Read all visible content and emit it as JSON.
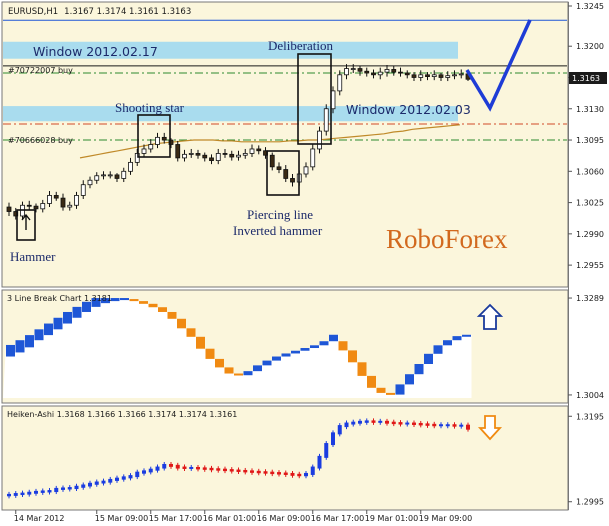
{
  "colors": {
    "panel_bg": "#fbf6dc",
    "hist_bg": "#ffffff",
    "axis_bg": "#ffffff",
    "bull": "#ffffff",
    "bear": "#3a2a14",
    "window_fill": "#a9dcee",
    "ma_line": "#c08a2a",
    "blue_box": "#1e56d6",
    "orange_box": "#f08a12",
    "ha_blue": "#1a3ce0",
    "ha_red": "#e01818",
    "level_green": "#2e8b2e",
    "level_red": "#d04a28",
    "pointer_blue": "#1e3cd6",
    "brand": "#d2691e",
    "text_dark": "#1a1a1a",
    "annotation": "#1c2a6a",
    "current_price_bg": "#1a1a1a"
  },
  "header": {
    "symbol": "EURUSD,H1",
    "ohlc": "1.3167 1.3174 1.3161 1.3163"
  },
  "labels": {
    "buy_level_1": "#70722007 buy",
    "buy_level_2": "#70666028 buy",
    "brand": "RoboForex",
    "line_break_title": "3 Line Break Chart 1.3181",
    "heiken_title": "Heiken-Ashi 1.3168 1.3166 1.3166 1.3174 1.3174 1.3161",
    "window_1": "Window 2012.02.17",
    "window_2": "Window 2012.02.03",
    "hammer": "Hammer",
    "shooting_star": "Shooting star",
    "deliberation": "Deliberation",
    "piercing_line": "Piercing line",
    "inverted_hammer": "Inverted hammer",
    "up_arrow_icon": "up-arrow-icon",
    "down_arrow_icon": "down-arrow-icon"
  },
  "chart_data": [
    {
      "type": "candlestick",
      "ylim": [
        1.2935,
        1.3245
      ],
      "y_ticks": [
        "1.3245",
        "1.3200",
        "1.3165",
        "1.3130",
        "1.3095",
        "1.3060",
        "1.3025",
        "1.2990",
        "1.2955"
      ],
      "current_price": "1.3163",
      "open": [
        1.302,
        1.3015,
        1.301,
        1.3022,
        1.3021,
        1.3018,
        1.3024,
        1.3033,
        1.303,
        1.302,
        1.3022,
        1.3033,
        1.3045,
        1.305,
        1.3055,
        1.3056,
        1.3056,
        1.3052,
        1.306,
        1.307,
        1.308,
        1.3085,
        1.309,
        1.3098,
        1.3095,
        1.309,
        1.3075,
        1.3079,
        1.308,
        1.3078,
        1.3075,
        1.3072,
        1.308,
        1.3079,
        1.3076,
        1.3078,
        1.308,
        1.3085,
        1.3083,
        1.3078,
        1.3065,
        1.3062,
        1.3052,
        1.3048,
        1.3057,
        1.3065,
        1.3085,
        1.3105,
        1.313,
        1.315,
        1.3168,
        1.3175,
        1.3175,
        1.3172,
        1.317,
        1.3168,
        1.3171,
        1.3174,
        1.3171,
        1.317,
        1.3168,
        1.3165,
        1.3168,
        1.3166,
        1.3168,
        1.3165,
        1.3167,
        1.3168,
        1.3169
      ],
      "close": [
        1.3015,
        1.301,
        1.3022,
        1.3021,
        1.3018,
        1.3024,
        1.3033,
        1.303,
        1.302,
        1.3022,
        1.3033,
        1.3045,
        1.305,
        1.3055,
        1.3056,
        1.3056,
        1.3052,
        1.306,
        1.307,
        1.308,
        1.3085,
        1.309,
        1.3098,
        1.3095,
        1.309,
        1.3075,
        1.3079,
        1.308,
        1.3078,
        1.3075,
        1.3072,
        1.308,
        1.3079,
        1.3076,
        1.3078,
        1.308,
        1.3085,
        1.3083,
        1.3078,
        1.3065,
        1.3062,
        1.3052,
        1.3048,
        1.3057,
        1.3065,
        1.3085,
        1.3105,
        1.313,
        1.315,
        1.3168,
        1.3175,
        1.3175,
        1.3172,
        1.317,
        1.3168,
        1.3171,
        1.3174,
        1.3171,
        1.317,
        1.3168,
        1.3165,
        1.3168,
        1.3166,
        1.3168,
        1.3165,
        1.3167,
        1.3168,
        1.3169,
        1.3163
      ],
      "high": [
        1.3025,
        1.3019,
        1.3026,
        1.3027,
        1.3024,
        1.3028,
        1.3038,
        1.3037,
        1.3035,
        1.3026,
        1.3037,
        1.305,
        1.3054,
        1.3059,
        1.306,
        1.306,
        1.3058,
        1.3064,
        1.3075,
        1.3085,
        1.309,
        1.3096,
        1.3103,
        1.3103,
        1.3097,
        1.3094,
        1.3084,
        1.3085,
        1.3084,
        1.3081,
        1.3079,
        1.3085,
        1.3085,
        1.3083,
        1.3083,
        1.3085,
        1.309,
        1.3089,
        1.3087,
        1.3081,
        1.307,
        1.3067,
        1.3057,
        1.3061,
        1.307,
        1.309,
        1.311,
        1.3135,
        1.3155,
        1.3173,
        1.318,
        1.318,
        1.3178,
        1.3176,
        1.3174,
        1.3176,
        1.3179,
        1.3178,
        1.3176,
        1.3173,
        1.3171,
        1.3173,
        1.3171,
        1.3173,
        1.317,
        1.3172,
        1.3173,
        1.3174,
        1.3174
      ],
      "low": [
        1.301,
        1.3006,
        1.3006,
        1.3017,
        1.3014,
        1.3014,
        1.302,
        1.3027,
        1.3016,
        1.3016,
        1.3018,
        1.3029,
        1.3041,
        1.3046,
        1.3051,
        1.3052,
        1.3048,
        1.3048,
        1.3056,
        1.3066,
        1.3076,
        1.3081,
        1.3086,
        1.3091,
        1.3086,
        1.3071,
        1.3071,
        1.3075,
        1.3074,
        1.3071,
        1.3068,
        1.3068,
        1.3075,
        1.3072,
        1.3072,
        1.3074,
        1.3076,
        1.3079,
        1.3074,
        1.3061,
        1.3058,
        1.3048,
        1.3043,
        1.3044,
        1.3053,
        1.3061,
        1.308,
        1.31,
        1.3125,
        1.3145,
        1.3163,
        1.317,
        1.3167,
        1.3166,
        1.3164,
        1.3163,
        1.3166,
        1.3167,
        1.3166,
        1.3164,
        1.3161,
        1.3161,
        1.3162,
        1.3162,
        1.3161,
        1.3161,
        1.3163,
        1.3164,
        1.3161
      ],
      "moving_average": [
        1.3075,
        1.3077,
        1.3079,
        1.3081,
        1.3083,
        1.3085,
        1.3087,
        1.3089,
        1.3091,
        1.3092,
        1.3093,
        1.3094,
        1.3095,
        1.3095,
        1.3095,
        1.3094,
        1.3094,
        1.3093,
        1.3093,
        1.3093,
        1.3093,
        1.3093,
        1.3094,
        1.3094,
        1.3095,
        1.3095,
        1.3096,
        1.3097,
        1.3098,
        1.3099,
        1.31,
        1.3101,
        1.3102,
        1.3104,
        1.3105,
        1.3107,
        1.3108,
        1.3109,
        1.311,
        1.3111,
        1.3112
      ],
      "moving_average_from_bar": 28,
      "windows": [
        {
          "label": "Window 2012.02.17",
          "from": 1.3186,
          "to": 1.3205
        },
        {
          "label": "Window 2012.02.03",
          "from": 1.3116,
          "to": 1.3133
        }
      ],
      "levels": [
        {
          "value": 1.3229,
          "color": "#1e56d6",
          "style": "solid"
        },
        {
          "value": 1.3178,
          "color": "#1a1a1a",
          "style": "solid"
        },
        {
          "value": 1.317,
          "color": "#2e8b2e",
          "style": "dash-dot"
        },
        {
          "value": 1.3113,
          "color": "#d04a28",
          "style": "dash-dot"
        },
        {
          "value": 1.3095,
          "color": "#2e8b2e",
          "style": "dash-dot"
        }
      ]
    },
    {
      "type": "line_break",
      "title": "3 Line Break Chart 1.3181",
      "y_ticks": [
        "1.3289",
        "1.3004"
      ],
      "ylim": [
        1.2995,
        1.3295
      ],
      "bricks": [
        {
          "lo": 1.3117,
          "hi": 1.3151,
          "dir": "up"
        },
        {
          "lo": 1.3129,
          "hi": 1.3165,
          "dir": "up"
        },
        {
          "lo": 1.3144,
          "hi": 1.318,
          "dir": "up"
        },
        {
          "lo": 1.3165,
          "hi": 1.3197,
          "dir": "up"
        },
        {
          "lo": 1.318,
          "hi": 1.3214,
          "dir": "up"
        },
        {
          "lo": 1.3197,
          "hi": 1.3231,
          "dir": "up"
        },
        {
          "lo": 1.3214,
          "hi": 1.3248,
          "dir": "up"
        },
        {
          "lo": 1.3231,
          "hi": 1.3263,
          "dir": "up"
        },
        {
          "lo": 1.3248,
          "hi": 1.3278,
          "dir": "up"
        },
        {
          "lo": 1.3263,
          "hi": 1.3289,
          "dir": "up"
        },
        {
          "lo": 1.3274,
          "hi": 1.3289,
          "dir": "up"
        },
        {
          "lo": 1.328,
          "hi": 1.3289,
          "dir": "up"
        },
        {
          "lo": 1.3283,
          "hi": 1.3289,
          "dir": "up"
        },
        {
          "lo": 1.328,
          "hi": 1.3286,
          "dir": "down"
        },
        {
          "lo": 1.3272,
          "hi": 1.328,
          "dir": "down"
        },
        {
          "lo": 1.3262,
          "hi": 1.3272,
          "dir": "down"
        },
        {
          "lo": 1.3248,
          "hi": 1.3262,
          "dir": "down"
        },
        {
          "lo": 1.3228,
          "hi": 1.3248,
          "dir": "down"
        },
        {
          "lo": 1.32,
          "hi": 1.3228,
          "dir": "down"
        },
        {
          "lo": 1.3175,
          "hi": 1.32,
          "dir": "down"
        },
        {
          "lo": 1.314,
          "hi": 1.3175,
          "dir": "down"
        },
        {
          "lo": 1.311,
          "hi": 1.314,
          "dir": "down"
        },
        {
          "lo": 1.3085,
          "hi": 1.311,
          "dir": "down"
        },
        {
          "lo": 1.3067,
          "hi": 1.3085,
          "dir": "down"
        },
        {
          "lo": 1.3062,
          "hi": 1.3067,
          "dir": "down"
        },
        {
          "lo": 1.3062,
          "hi": 1.3074,
          "dir": "up"
        },
        {
          "lo": 1.3074,
          "hi": 1.3091,
          "dir": "up"
        },
        {
          "lo": 1.3091,
          "hi": 1.3105,
          "dir": "up"
        },
        {
          "lo": 1.3105,
          "hi": 1.3117,
          "dir": "up"
        },
        {
          "lo": 1.3117,
          "hi": 1.3126,
          "dir": "up"
        },
        {
          "lo": 1.3126,
          "hi": 1.3134,
          "dir": "up"
        },
        {
          "lo": 1.3134,
          "hi": 1.3142,
          "dir": "up"
        },
        {
          "lo": 1.3142,
          "hi": 1.315,
          "dir": "up"
        },
        {
          "lo": 1.315,
          "hi": 1.3162,
          "dir": "up"
        },
        {
          "lo": 1.3162,
          "hi": 1.3181,
          "dir": "up"
        },
        {
          "lo": 1.3135,
          "hi": 1.3162,
          "dir": "down"
        },
        {
          "lo": 1.31,
          "hi": 1.3135,
          "dir": "down"
        },
        {
          "lo": 1.306,
          "hi": 1.31,
          "dir": "down"
        },
        {
          "lo": 1.3025,
          "hi": 1.306,
          "dir": "down"
        },
        {
          "lo": 1.301,
          "hi": 1.3025,
          "dir": "down"
        },
        {
          "lo": 1.3005,
          "hi": 1.301,
          "dir": "down"
        },
        {
          "lo": 1.3005,
          "hi": 1.3035,
          "dir": "up"
        },
        {
          "lo": 1.3035,
          "hi": 1.3065,
          "dir": "up"
        },
        {
          "lo": 1.3065,
          "hi": 1.3095,
          "dir": "up"
        },
        {
          "lo": 1.3095,
          "hi": 1.3125,
          "dir": "up"
        },
        {
          "lo": 1.3125,
          "hi": 1.315,
          "dir": "up"
        },
        {
          "lo": 1.315,
          "hi": 1.3165,
          "dir": "up"
        },
        {
          "lo": 1.3165,
          "hi": 1.3177,
          "dir": "up"
        },
        {
          "lo": 1.3177,
          "hi": 1.3181,
          "dir": "up"
        }
      ]
    },
    {
      "type": "heiken_ashi",
      "title": "Heiken-Ashi 1.3168 1.3166 1.3166 1.3174 1.3174 1.3161",
      "y_ticks": [
        "1.3195",
        "1.2995"
      ],
      "ylim": [
        1.2985,
        1.3205
      ],
      "open": [
        1.301,
        1.3011,
        1.3013,
        1.3014,
        1.3016,
        1.3018,
        1.3019,
        1.302,
        1.3025,
        1.3026,
        1.3027,
        1.303,
        1.3033,
        1.3037,
        1.304,
        1.3042,
        1.3046,
        1.3049,
        1.3052,
        1.3055,
        1.3063,
        1.3066,
        1.307,
        1.3075,
        1.3081,
        1.3079,
        1.3075,
        1.3074,
        1.3074,
        1.3073,
        1.3072,
        1.3071,
        1.307,
        1.3069,
        1.3068,
        1.3067,
        1.3066,
        1.3065,
        1.3064,
        1.3063,
        1.3062,
        1.3061,
        1.306,
        1.3058,
        1.3057,
        1.306,
        1.3075,
        1.31,
        1.313,
        1.3155,
        1.3172,
        1.3178,
        1.318,
        1.3182,
        1.3183,
        1.3182,
        1.3182,
        1.318,
        1.3179,
        1.3178,
        1.3178,
        1.3177,
        1.3176,
        1.3175,
        1.3174,
        1.3174,
        1.3174,
        1.3173,
        1.3173
      ],
      "close": [
        1.3011,
        1.3013,
        1.3014,
        1.3016,
        1.3018,
        1.3019,
        1.302,
        1.3025,
        1.3026,
        1.3027,
        1.303,
        1.3033,
        1.3037,
        1.304,
        1.3042,
        1.3046,
        1.3049,
        1.3052,
        1.3055,
        1.3063,
        1.3066,
        1.307,
        1.3075,
        1.3081,
        1.3079,
        1.3075,
        1.3074,
        1.3074,
        1.3073,
        1.3072,
        1.3071,
        1.307,
        1.3069,
        1.3068,
        1.3067,
        1.3066,
        1.3065,
        1.3064,
        1.3063,
        1.3062,
        1.3061,
        1.306,
        1.3058,
        1.3057,
        1.306,
        1.3075,
        1.31,
        1.313,
        1.3155,
        1.3172,
        1.3178,
        1.318,
        1.3182,
        1.3183,
        1.3182,
        1.3182,
        1.318,
        1.3179,
        1.3178,
        1.3178,
        1.3177,
        1.3176,
        1.3175,
        1.3174,
        1.3174,
        1.3174,
        1.3173,
        1.3173,
        1.3166
      ]
    }
  ],
  "x_axis": {
    "ticks": [
      {
        "bar": 1,
        "label": "14 Mar 2012"
      },
      {
        "bar": 13,
        "label": "15 Mar 09:00"
      },
      {
        "bar": 21,
        "label": "15 Mar 17:00"
      },
      {
        "bar": 29,
        "label": "16 Mar 01:00"
      },
      {
        "bar": 37,
        "label": "16 Mar 09:00"
      },
      {
        "bar": 45,
        "label": "16 Mar 17:00"
      },
      {
        "bar": 53,
        "label": "19 Mar 01:00"
      },
      {
        "bar": 61,
        "label": "19 Mar 09:00"
      }
    ]
  }
}
